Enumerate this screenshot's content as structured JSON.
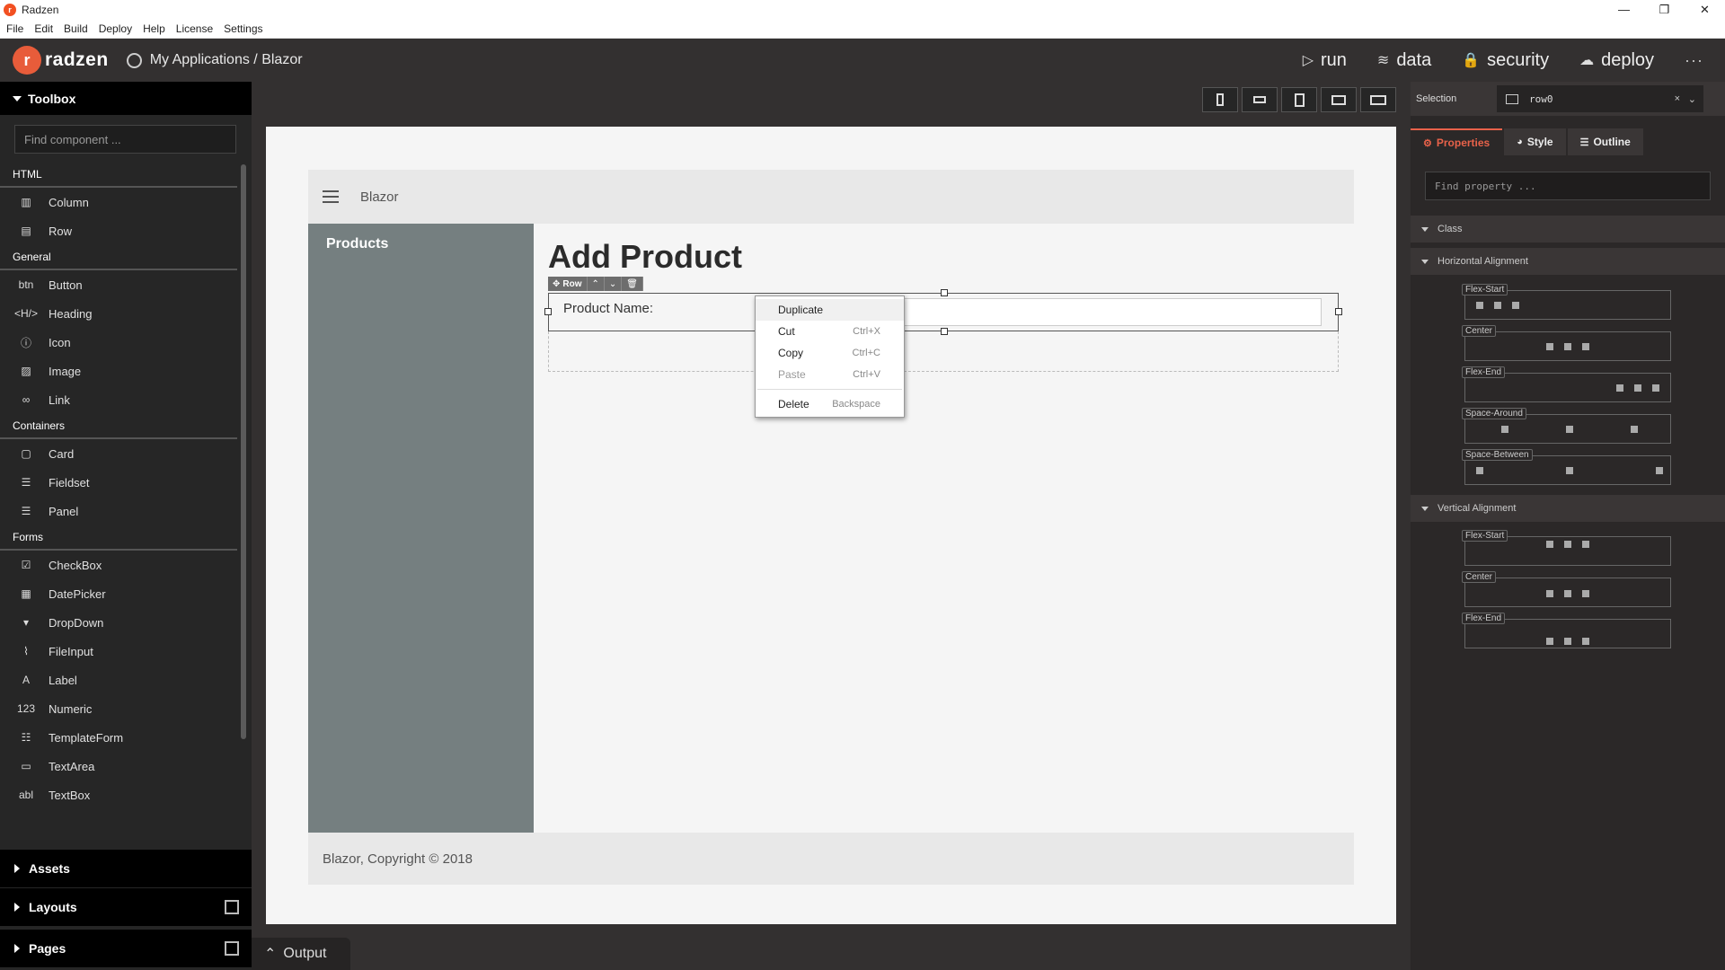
{
  "window": {
    "title": "Radzen",
    "app_icon": "radzen-app-icon",
    "controls": {
      "minimize": "—",
      "restore": "❐",
      "close": "✕"
    }
  },
  "menubar": [
    "File",
    "Edit",
    "Build",
    "Deploy",
    "Help",
    "License",
    "Settings"
  ],
  "appbar": {
    "logo_text": "radzen",
    "logo_mark": "r",
    "breadcrumb": "My Applications / Blazor",
    "actions": [
      {
        "icon": "play-icon",
        "glyph": "▷",
        "label": "run"
      },
      {
        "icon": "layers-icon",
        "glyph": "≋",
        "label": "data"
      },
      {
        "icon": "lock-icon",
        "glyph": "🔒",
        "label": "security"
      },
      {
        "icon": "cloud-upload-icon",
        "glyph": "☁",
        "label": "deploy"
      }
    ],
    "more": "···"
  },
  "toolbox": {
    "title": "Toolbox",
    "search_placeholder": "Find component ...",
    "sections": [
      {
        "title": "HTML",
        "items": [
          {
            "icon": "column-icon",
            "glyph": "▥",
            "label": "Column"
          },
          {
            "icon": "row-icon",
            "glyph": "▤",
            "label": "Row"
          }
        ]
      },
      {
        "title": "General",
        "items": [
          {
            "icon": "button-icon",
            "glyph": "btn",
            "label": "Button"
          },
          {
            "icon": "heading-icon",
            "glyph": "<H/>",
            "label": "Heading"
          },
          {
            "icon": "info-icon",
            "glyph": "ⓘ",
            "label": "Icon"
          },
          {
            "icon": "image-icon",
            "glyph": "▨",
            "label": "Image"
          },
          {
            "icon": "link-icon",
            "glyph": "∞",
            "label": "Link"
          }
        ]
      },
      {
        "title": "Containers",
        "items": [
          {
            "icon": "card-icon",
            "glyph": "▢",
            "label": "Card"
          },
          {
            "icon": "fieldset-icon",
            "glyph": "☰",
            "label": "Fieldset"
          },
          {
            "icon": "panel-icon",
            "glyph": "☰",
            "label": "Panel"
          }
        ]
      },
      {
        "title": "Forms",
        "items": [
          {
            "icon": "checkbox-icon",
            "glyph": "☑",
            "label": "CheckBox"
          },
          {
            "icon": "calendar-icon",
            "glyph": "▦",
            "label": "DatePicker"
          },
          {
            "icon": "dropdown-icon",
            "glyph": "▾",
            "label": "DropDown"
          },
          {
            "icon": "paperclip-icon",
            "glyph": "⌇",
            "label": "FileInput"
          },
          {
            "icon": "label-icon",
            "glyph": "A",
            "label": "Label"
          },
          {
            "icon": "numeric-icon",
            "glyph": "123",
            "label": "Numeric"
          },
          {
            "icon": "template-form-icon",
            "glyph": "☷",
            "label": "TemplateForm"
          },
          {
            "icon": "textarea-icon",
            "glyph": "▭",
            "label": "TextArea"
          },
          {
            "icon": "textbox-icon",
            "glyph": "abl",
            "label": "TextBox"
          }
        ]
      }
    ],
    "footer": [
      {
        "label": "Assets",
        "has_add": false
      },
      {
        "label": "Layouts",
        "has_add": true
      },
      {
        "label": "Pages",
        "has_add": true
      }
    ]
  },
  "canvas": {
    "device_buttons": [
      "phone-portrait",
      "phone-landscape",
      "tablet-portrait",
      "tablet-landscape",
      "desktop"
    ],
    "app_brand": "Blazor",
    "nav_item": "Products",
    "page_title": "Add Product",
    "row_toolbar": {
      "label": "Row",
      "move_icon": "✥",
      "up": "⌃",
      "down": "⌄",
      "delete": "🗑"
    },
    "field_label": "Product Name:",
    "footer_text": "Blazor, Copyright © 2018"
  },
  "context_menu": {
    "items": [
      {
        "label": "Duplicate",
        "shortcut": "",
        "state": "highlight"
      },
      {
        "label": "Cut",
        "shortcut": "Ctrl+X",
        "state": "normal"
      },
      {
        "label": "Copy",
        "shortcut": "Ctrl+C",
        "state": "normal"
      },
      {
        "label": "Paste",
        "shortcut": "Ctrl+V",
        "state": "disabled"
      }
    ],
    "delete": {
      "label": "Delete",
      "shortcut": "Backspace"
    }
  },
  "properties": {
    "selection_label": "Selection",
    "selection_value": "row0",
    "tabs": [
      {
        "label": "Properties",
        "glyph": "⚙",
        "active": true
      },
      {
        "label": "Style",
        "glyph": "◕",
        "active": false
      },
      {
        "label": "Outline",
        "glyph": "☰",
        "active": false
      }
    ],
    "find_placeholder": "Find property ...",
    "sections": {
      "class": "Class",
      "horizontal": "Horizontal Alignment",
      "vertical": "Vertical Alignment"
    },
    "horizontal_options": [
      "Flex-Start",
      "Center",
      "Flex-End",
      "Space-Around",
      "Space-Between"
    ],
    "vertical_options": [
      "Flex-Start",
      "Center",
      "Flex-End"
    ]
  },
  "output": {
    "label": "Output",
    "chevron": "⌃"
  },
  "colors": {
    "accent": "#e8624a",
    "sidebar": "#757f80"
  }
}
